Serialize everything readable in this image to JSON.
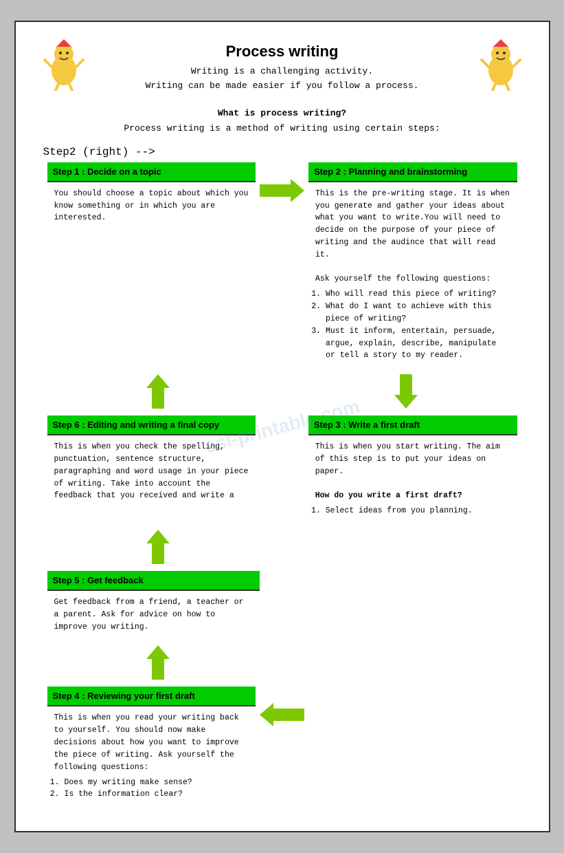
{
  "page": {
    "title": "Process writing",
    "subtitle1": "Writing is a challenging activity.",
    "subtitle2": "Writing can be made easier if you follow a process.",
    "intro_q": "What is process writing?",
    "intro_body": "Process writing is a method of writing using certain steps:",
    "watermark": "esl-printable.com"
  },
  "steps": {
    "step1": {
      "header": "Step 1 : Decide on a topic",
      "body": "You should choose a topic about which you know something or in which you are interested."
    },
    "step2": {
      "header": "Step 2 : Planning and brainstorming",
      "body_intro": "This is the pre-writing stage.  It is when you generate and gather your ideas about what you want to write.You will need to decide on the purpose of your piece of writing and the audince that will read it.",
      "body_ask": "Ask yourself the following questions:",
      "q1": "Who will read this piece of writing?",
      "q2": "What do I want to achieve with this piece of writing?",
      "q3": "Must it inform, entertain, persuade, argue, explain, describe, manipulate or tell a story to my reader."
    },
    "step3": {
      "header": "Step 3 : Write a first draft",
      "body_intro": "This is when you start writing.  The aim of this step is to put your ideas on paper.",
      "body_q": "How do you write a first draft?",
      "q1": "Select ideas from you planning."
    },
    "step4": {
      "header": "Step 4 : Reviewing your first draft",
      "body_intro": "This is when you read your writing back to yourself.  You should now make decisions about how you want to improve the piece of writing.  Ask yourself the following questions:",
      "q1": "Does my writing make sense?",
      "q2": "Is the information clear?"
    },
    "step5": {
      "header": "Step 5 : Get feedback",
      "body": "Get feedback from a friend, a teacher or a parent.  Ask for advice on how to improve you writing."
    },
    "step6": {
      "header": "Step 6 : Editing and writing a final copy",
      "body": "This is when you check the spelling, punctuation, sentence structure, paragraphing and word usage in your piece of writing. Take into account the feedback that you received and write a"
    }
  }
}
